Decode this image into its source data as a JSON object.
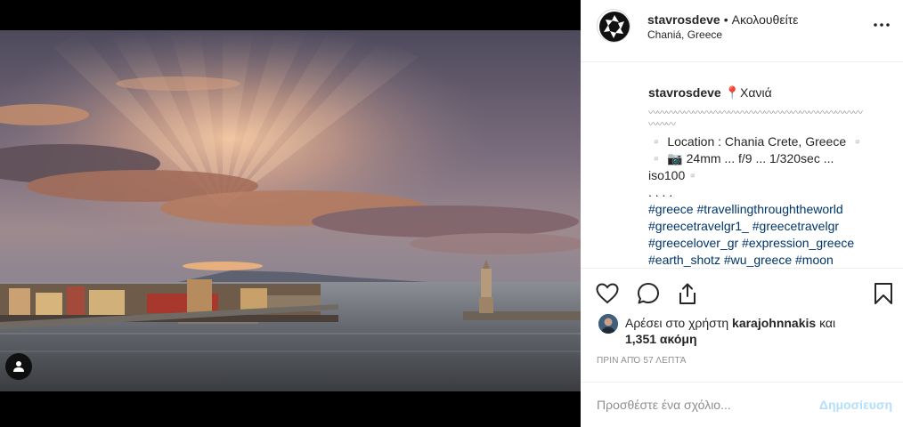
{
  "post": {
    "username": "stavrosdeve",
    "follow_state": "Ακολουθείτε",
    "separator": "•",
    "location": "Chaniá, Greece",
    "more_icon": "ellipsis-icon"
  },
  "caption": {
    "username": "stavrosdeve",
    "title": "📍Χανιά",
    "wave_line_1": "〰〰〰〰〰〰〰〰〰〰〰〰〰〰〰〰〰〰〰〰〰〰〰〰",
    "wave_line_2": "〰〰〰",
    "line_location": "▫️ Location : Chania Crete, Greece ▫️",
    "line_camera_1": "▫️ 📷 24mm ... f/9 ... 1/320sec ...",
    "line_camera_2": "iso100▫️",
    "line_dots": ". . . .",
    "hashtags": [
      "#greece",
      "#travellingthroughtheworld",
      "#greecetravelgr1_",
      "#greecetravelgr",
      "#greecelover_gr",
      "#expression_greece",
      "#earth_shotz",
      "#wu_greece",
      "#moon"
    ]
  },
  "actions": {
    "like_icon": "heart-icon",
    "comment_icon": "comment-icon",
    "share_icon": "share-icon",
    "save_icon": "bookmark-icon"
  },
  "likes": {
    "prefix": "Αρέσει στο χρήστη",
    "user": "karajohnnakis",
    "conjunction": "και",
    "count": "1,351 ακόμη"
  },
  "timestamp": "ΠΡΙΝ ΑΠΌ 57 ΛΕΠΤΆ",
  "comment": {
    "placeholder": "Προσθέστε ένα σχόλιο...",
    "post_label": "Δημοσίευση"
  },
  "colors": {
    "link": "#003569",
    "post_disabled": "#b2dffc",
    "secondary_text": "#8e8e8e"
  }
}
